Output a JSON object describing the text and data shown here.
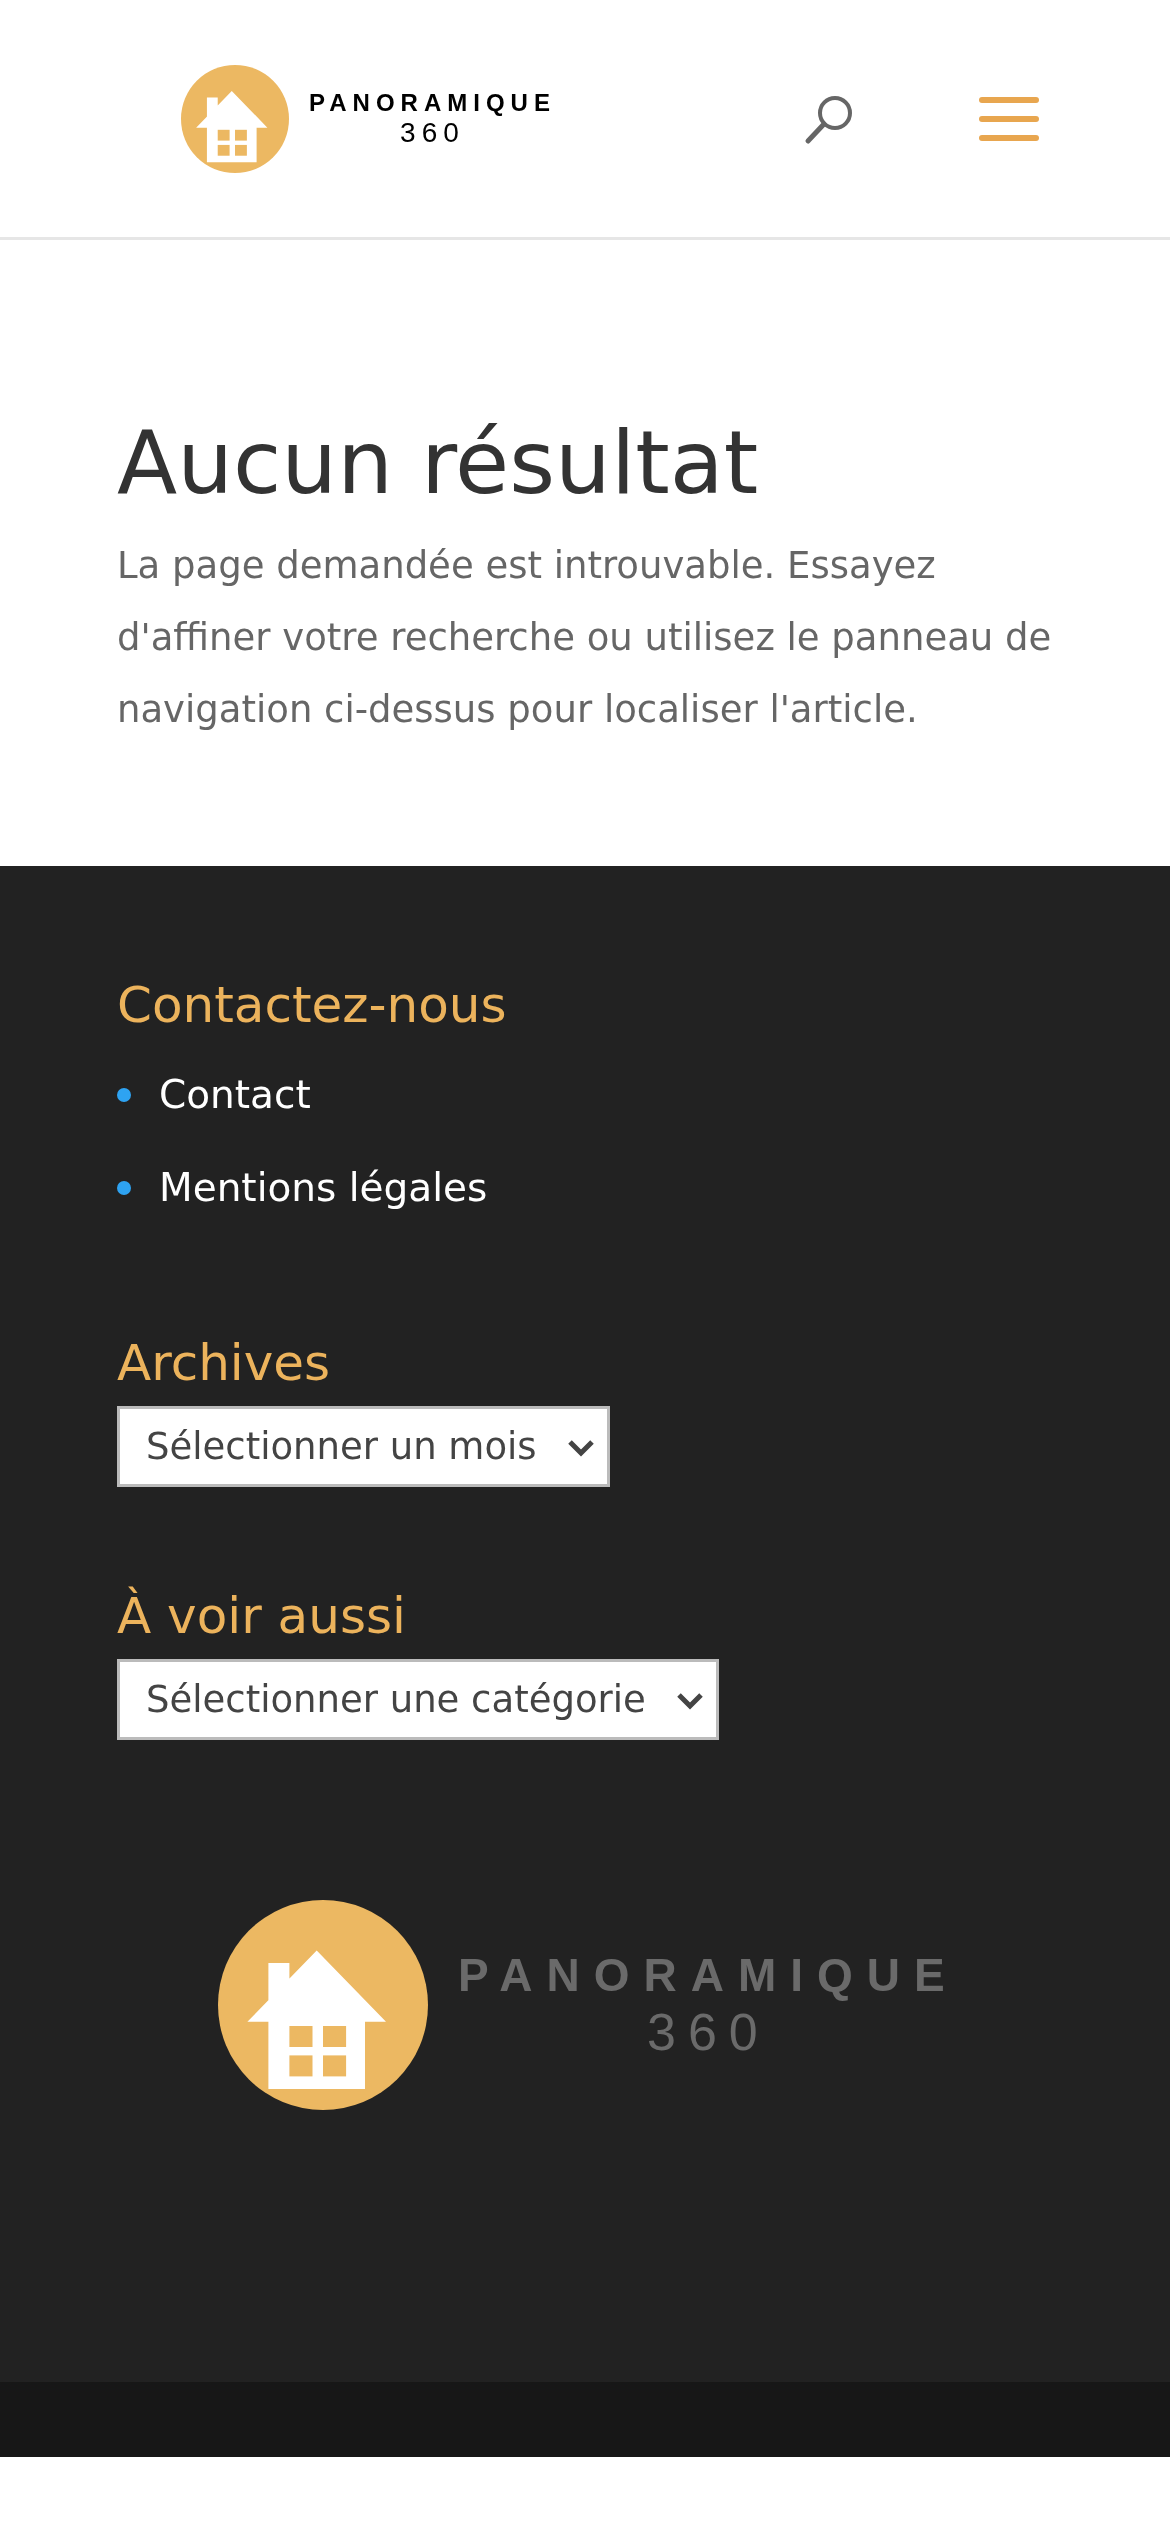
{
  "header": {
    "logo": {
      "name": "PANORAMIQUE",
      "number": "360"
    }
  },
  "main": {
    "title": "Aucun résultat",
    "message": "La page demandée est introuvable. Essayez d'affiner votre recherche ou utilisez le panneau de navigation ci-dessus pour localiser l'article."
  },
  "footer": {
    "widgets": [
      {
        "kind": "links",
        "title": "Contactez-nous",
        "items": [
          "Contact",
          "Mentions légales"
        ]
      },
      {
        "kind": "dropdown",
        "title": "Archives",
        "value": "Sélectionner un mois"
      },
      {
        "kind": "dropdown",
        "title": "À voir aussi",
        "value": "Sélectionner une catégorie"
      }
    ],
    "logo": {
      "name": "PANORAMIQUE",
      "number": "360"
    }
  }
}
